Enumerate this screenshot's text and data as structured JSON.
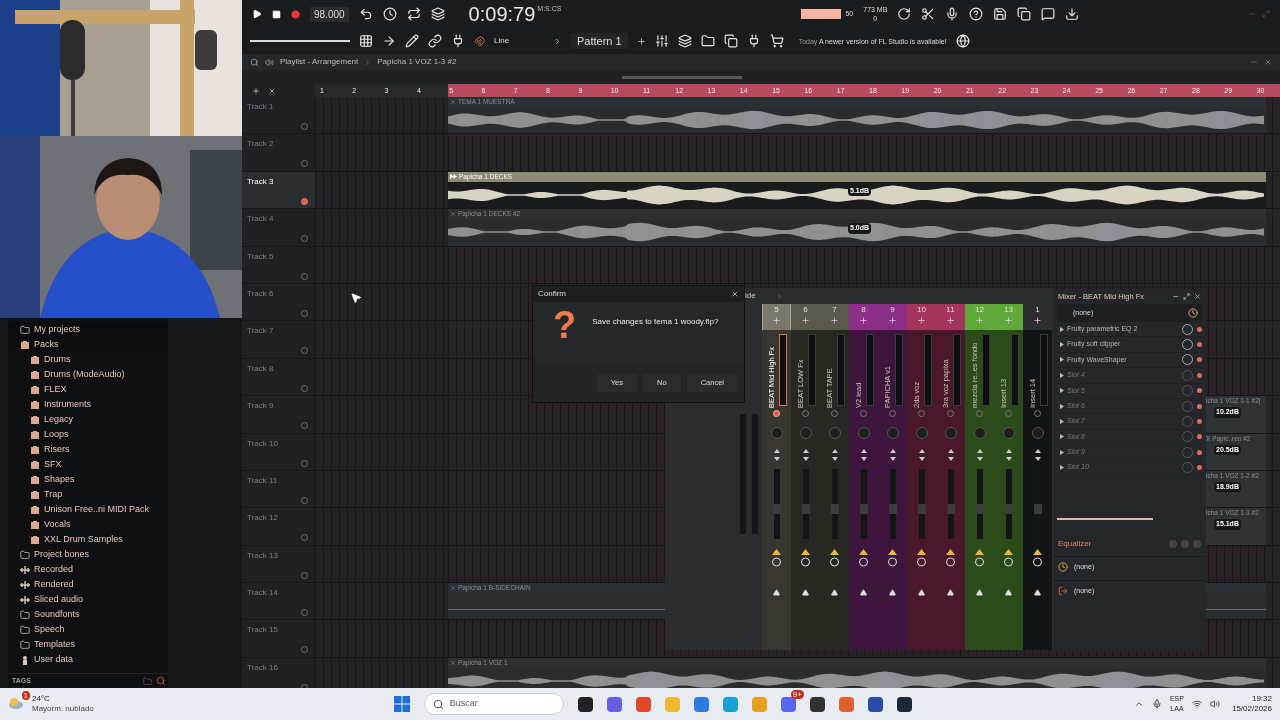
{
  "toolbar": {
    "tempo": "98.000",
    "time": "0:09:79",
    "time_unit": "M:S:CS",
    "cpu": "50",
    "memory": "773 MB",
    "polyphony": "0",
    "snap": "Line",
    "pattern": "Pattern 1",
    "news_date": "Today",
    "news": "A newer version of FL Studio is available!"
  },
  "browser": {
    "items": [
      {
        "label": "My projects",
        "kind": "folder"
      },
      {
        "label": "Packs",
        "kind": "pack",
        "children": [
          {
            "label": "Drums",
            "kind": "pack"
          },
          {
            "label": "Drums (ModeAudio)",
            "kind": "pack"
          },
          {
            "label": "FLEX",
            "kind": "pack"
          },
          {
            "label": "Instruments",
            "kind": "pack"
          },
          {
            "label": "Legacy",
            "kind": "pack"
          },
          {
            "label": "Loops",
            "kind": "pack"
          },
          {
            "label": "Risers",
            "kind": "pack"
          },
          {
            "label": "SFX",
            "kind": "pack"
          },
          {
            "label": "Shapes",
            "kind": "pack"
          },
          {
            "label": "Trap",
            "kind": "pack"
          },
          {
            "label": "Unison Free..ni MIDI Pack",
            "kind": "pack"
          },
          {
            "label": "Vocals",
            "kind": "pack"
          },
          {
            "label": "XXL Drum Samples",
            "kind": "pack"
          }
        ]
      },
      {
        "label": "Project bones",
        "kind": "folder"
      },
      {
        "label": "Recorded",
        "kind": "audio"
      },
      {
        "label": "Rendered",
        "kind": "audio"
      },
      {
        "label": "Sliced audio",
        "kind": "audio"
      },
      {
        "label": "Soundfonts",
        "kind": "folder"
      },
      {
        "label": "Speech",
        "kind": "folder"
      },
      {
        "label": "Templates",
        "kind": "folder"
      },
      {
        "label": "User data",
        "kind": "data"
      }
    ],
    "tags_label": "TAGS"
  },
  "playlist": {
    "title": "Playlist - Arrangement",
    "current_clip": "Papicha 1 VOZ 1-3 #2",
    "ruler": [
      "1",
      "2",
      "3",
      "4",
      "5",
      "6",
      "7",
      "8",
      "9",
      "10",
      "11",
      "12",
      "13",
      "14",
      "15",
      "16",
      "17",
      "18",
      "19",
      "20",
      "21",
      "22",
      "23",
      "24",
      "25",
      "26",
      "27",
      "28",
      "29",
      "30"
    ],
    "tracks": [
      {
        "name": "Track 1",
        "selected": false,
        "clips": [
          {
            "kind": "full",
            "label": "TEMA 1 MUESTRA",
            "selected": false
          }
        ]
      },
      {
        "name": "Track 2",
        "selected": false
      },
      {
        "name": "Track 3",
        "selected": true,
        "clips": [
          {
            "kind": "full",
            "label": "Papicha 1 DECKS",
            "selected": true,
            "gain": "5.1dB"
          }
        ]
      },
      {
        "name": "Track 4",
        "selected": false,
        "clips": [
          {
            "kind": "full",
            "label": "Papicha 1 DECKS #2",
            "selected": false,
            "gain": "5.0dB"
          }
        ]
      },
      {
        "name": "Track 5",
        "selected": false
      },
      {
        "name": "Track 6",
        "selected": false
      },
      {
        "name": "Track 7",
        "selected": false
      },
      {
        "name": "Track 8",
        "selected": false
      },
      {
        "name": "Track 9",
        "selected": false,
        "clips": [
          {
            "kind": "tail",
            "label": "icha 1 VOZ 1-1 #2|",
            "selected": false,
            "gain": "10.2dB"
          }
        ]
      },
      {
        "name": "Track 10",
        "selected": false,
        "clips": [
          {
            "kind": "tail",
            "label": "X Papic..reo #2",
            "selected": false,
            "gain": "20.5dB"
          }
        ]
      },
      {
        "name": "Track 11",
        "selected": false,
        "clips": [
          {
            "kind": "tail",
            "label": "icha 1 VOZ 1-2 #2",
            "selected": false,
            "gain": "18.9dB"
          }
        ]
      },
      {
        "name": "Track 12",
        "selected": false,
        "clips": [
          {
            "kind": "tail",
            "label": "icha 1 VOZ 1-3 #2",
            "selected": false,
            "gain": "15.1dB"
          }
        ]
      },
      {
        "name": "Track 13",
        "selected": false
      },
      {
        "name": "Track 14",
        "selected": false,
        "clips": [
          {
            "kind": "flat",
            "label": "Papicha 1 B-SIDECHAIN",
            "selected": false
          }
        ]
      },
      {
        "name": "Track 15",
        "selected": false
      },
      {
        "name": "Track 16",
        "selected": false,
        "clips": [
          {
            "kind": "full",
            "label": "Papicha 1 VOZ 1",
            "selected": false
          }
        ]
      }
    ]
  },
  "dialog": {
    "title": "Confirm",
    "icon": "?",
    "message": "Save changes to tema 1 woody.flp?",
    "buttons": [
      "Yes",
      "No",
      "Cancel"
    ]
  },
  "mixer": {
    "title_fragment": "ide",
    "strips": [
      {
        "number": "5",
        "name": "BEAT Mid High Fx",
        "color": "#7a796b",
        "selected": true
      },
      {
        "number": "6",
        "name": "BEAT LOW Fx",
        "color": "#5a594e",
        "selected": false
      },
      {
        "number": "7",
        "name": "BEAT TAPE",
        "color": "#5a594e",
        "selected": false
      },
      {
        "number": "8",
        "name": "V2 lead",
        "color": "#8b2f88",
        "selected": false
      },
      {
        "number": "9",
        "name": "PAPICHA v1",
        "color": "#8b2f88",
        "selected": false
      },
      {
        "number": "10",
        "name": "2da voz",
        "color": "#a3355f",
        "selected": false
      },
      {
        "number": "11",
        "name": "3ra voz papixa",
        "color": "#a3355f",
        "selected": false
      },
      {
        "number": "12",
        "name": "mezcla re..es fondo",
        "color": "#5fa93b",
        "selected": false
      },
      {
        "number": "13",
        "name": "Insert 13",
        "color": "#5fa93b",
        "selected": false
      },
      {
        "number": "1",
        "name": "Insert 14",
        "color": "#2c2e30",
        "selected": false
      }
    ],
    "fx": {
      "title": "Mixer - BEAT Mid High Fx",
      "input": "(none)",
      "slots": [
        {
          "name": "Fruity parametric EQ 2",
          "empty": false
        },
        {
          "name": "Fruity soft clipper",
          "empty": false
        },
        {
          "name": "Fruity WaveShaper",
          "empty": false
        },
        {
          "name": "Slot 4",
          "empty": true
        },
        {
          "name": "Slot 5",
          "empty": true
        },
        {
          "name": "Slot 6",
          "empty": true
        },
        {
          "name": "Slot 7",
          "empty": true
        },
        {
          "name": "Slot 8",
          "empty": true
        },
        {
          "name": "Slot 9",
          "empty": true
        },
        {
          "name": "Slot 10",
          "empty": true
        }
      ],
      "eq_label": "Equalizer",
      "outputs": [
        "(none)",
        "(none)"
      ]
    }
  },
  "taskbar": {
    "weather_badge": "1",
    "temperature": "24°C",
    "condition": "Mayorm. nublado",
    "search_placeholder": "Buscar",
    "chat_badge": "9+",
    "language": "ESP",
    "layout": "LAA",
    "time": "19:32",
    "date": "15/02/2026"
  }
}
